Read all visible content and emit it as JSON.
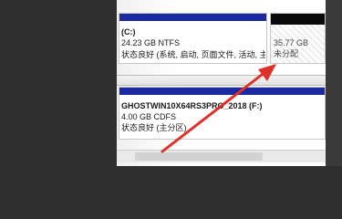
{
  "partitions": [
    {
      "id": "c",
      "name": "(C:)",
      "size": "24.23 GB NTFS",
      "status": "状态良好 (系统, 启动, 页面文件, 活动, 主"
    },
    {
      "id": "unallocated",
      "size": "35.77 GB",
      "label": "未分配"
    },
    {
      "id": "f",
      "name": "GHOSTWIN10X64RS3PRO_2018 (F:)",
      "size": "4.00 GB CDFS",
      "status": "状态良好 (主分区)"
    }
  ],
  "colors": {
    "primary_bar": "#1b2aa1",
    "unallocated_bar": "#0a0a0a",
    "annotation_arrow": "#e0302a"
  }
}
